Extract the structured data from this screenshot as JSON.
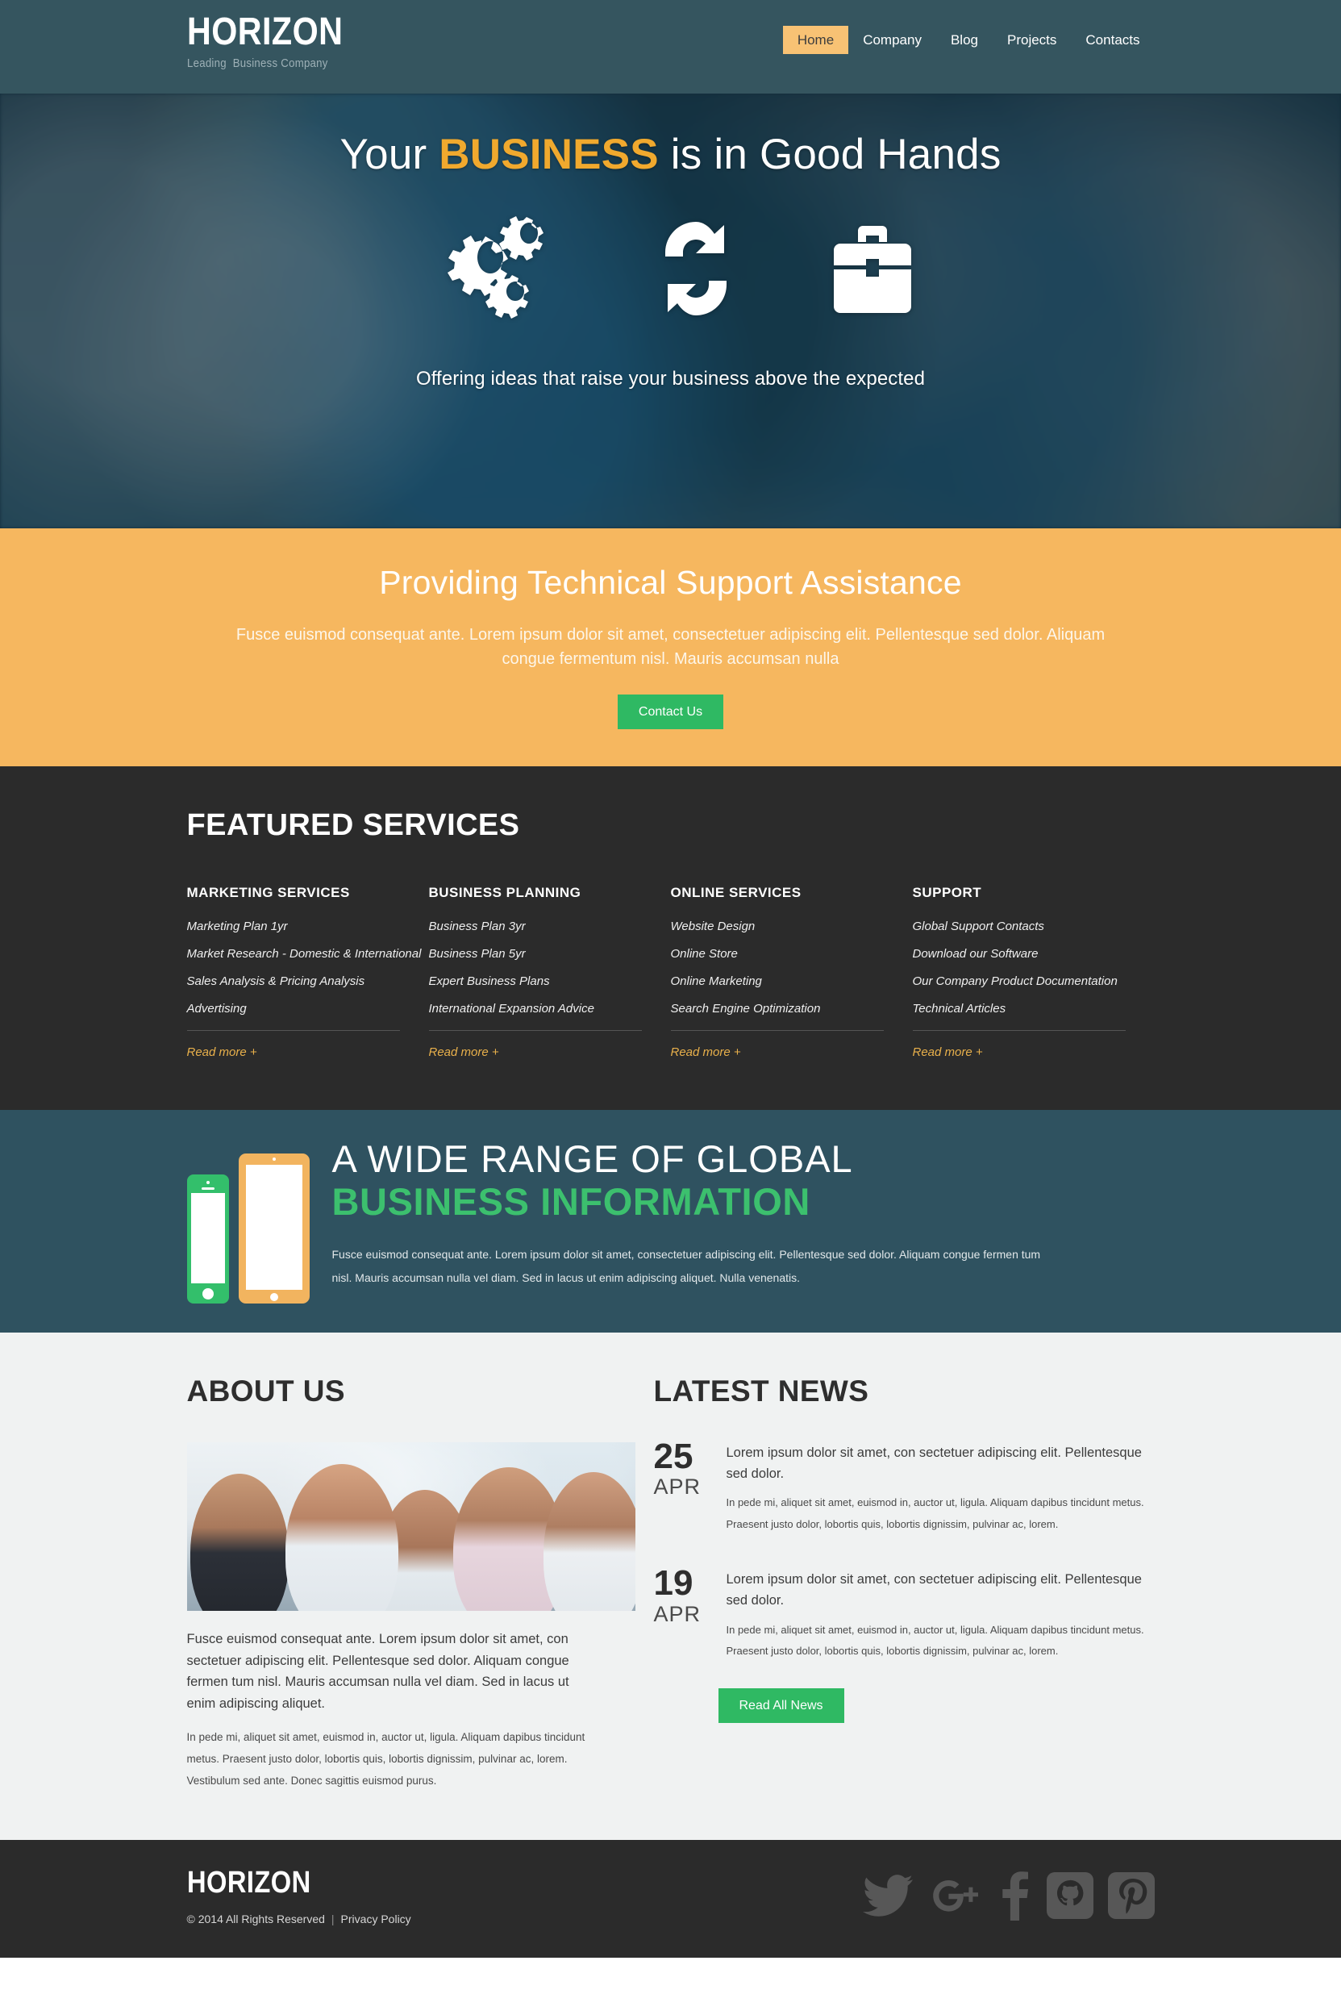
{
  "header": {
    "brand_name": "HORIZON",
    "brand_tagline": "Leading  Business Company",
    "nav": [
      {
        "label": "Home",
        "active": true
      },
      {
        "label": "Company",
        "active": false
      },
      {
        "label": "Blog",
        "active": false
      },
      {
        "label": "Projects",
        "active": false
      },
      {
        "label": "Contacts",
        "active": false
      }
    ]
  },
  "hero": {
    "title_pre": "Your ",
    "title_highlight": "BUSINESS",
    "title_post": " is in Good Hands",
    "subtitle": "Offering ideas that raise your business above the expected",
    "icons": [
      "gears-icon",
      "refresh-icon",
      "briefcase-icon"
    ]
  },
  "callout": {
    "title": "Providing Technical Support Assistance",
    "text": "Fusce euismod consequat ante. Lorem ipsum dolor sit amet, consectetuer adipiscing elit. Pellentesque sed dolor. Aliquam congue fermentum nisl. Mauris accumsan nulla",
    "button": "Contact Us"
  },
  "services": {
    "title": "FEATURED SERVICES",
    "read_more": "Read more +",
    "columns": [
      {
        "title": "MARKETING SERVICES",
        "items": [
          "Marketing Plan 1yr",
          "Market Research - Domestic & International",
          "Sales Analysis & Pricing Analysis",
          "Advertising"
        ]
      },
      {
        "title": "BUSINESS PLANNING",
        "items": [
          "Business Plan 3yr",
          "Business Plan 5yr",
          "Expert Business Plans",
          "International Expansion Advice"
        ]
      },
      {
        "title": "ONLINE SERVICES",
        "items": [
          "Website Design",
          "Online Store",
          "Online Marketing",
          "Search Engine Optimization"
        ]
      },
      {
        "title": "SUPPORT",
        "items": [
          "Global Support Contacts",
          "Download our Software",
          "Our Company Product Documentation",
          "Technical Articles"
        ]
      }
    ]
  },
  "info": {
    "heading_line1": "A WIDE RANGE OF GLOBAL",
    "heading_line2": "BUSINESS INFORMATION",
    "paragraph": "Fusce euismod consequat ante. Lorem ipsum dolor sit amet, consectetuer adipiscing elit. Pellentesque sed dolor. Aliquam congue fermen tum nisl. Mauris accumsan nulla vel diam. Sed in lacus ut enim adipiscing aliquet. Nulla venenatis.",
    "devices": [
      "smartphone-graphic",
      "tablet-graphic"
    ]
  },
  "about": {
    "title": "ABOUT US",
    "photo_alt": "business-team-photo",
    "lead": "Fusce euismod consequat ante. Lorem ipsum dolor sit amet, con sectetuer adipiscing elit. Pellentesque sed dolor. Aliquam congue fermen tum nisl. Mauris accumsan nulla vel diam. Sed in lacus ut enim adipiscing aliquet.",
    "body": "In pede mi, aliquet sit amet, euismod in, auctor ut, ligula. Aliquam dapibus tincidunt metus. Praesent justo dolor, lobortis quis, lobortis dignissim, pulvinar ac, lorem. Vestibulum sed ante. Donec sagittis euismod purus."
  },
  "news": {
    "title": "LATEST NEWS",
    "button": "Read All News",
    "items": [
      {
        "day": "25",
        "month": "APR",
        "title": "Lorem ipsum dolor sit amet, con sectetuer adipiscing elit. Pellentesque sed dolor.",
        "text": "In pede mi, aliquet sit amet, euismod in, auctor ut, ligula. Aliquam dapibus tincidunt metus. Praesent justo dolor, lobortis quis, lobortis dignissim, pulvinar ac, lorem."
      },
      {
        "day": "19",
        "month": "APR",
        "title": "Lorem ipsum dolor sit amet, con sectetuer adipiscing elit. Pellentesque sed dolor.",
        "text": "In pede mi, aliquet sit amet, euismod in, auctor ut, ligula. Aliquam dapibus tincidunt metus. Praesent justo dolor, lobortis quis, lobortis dignissim, pulvinar ac, lorem."
      }
    ]
  },
  "footer": {
    "brand_name": "HORIZON",
    "copyright": "© 2014 All Rights Reserved",
    "separator": "|",
    "privacy": "Privacy Policy",
    "socials": [
      "twitter-icon",
      "google-plus-icon",
      "facebook-icon",
      "github-icon",
      "pinterest-icon"
    ]
  },
  "colors": {
    "header_teal": "#35555f",
    "accent_orange": "#f6b75f",
    "nav_active": "#f8c274",
    "green": "#2fb963",
    "info_teal": "#2f5260",
    "dark": "#2b2b2b",
    "light_bg": "#f0f2f2",
    "highlight_gold": "#f0a92e",
    "readmore_gold": "#e8b04b",
    "info_green": "#3cc06e"
  }
}
